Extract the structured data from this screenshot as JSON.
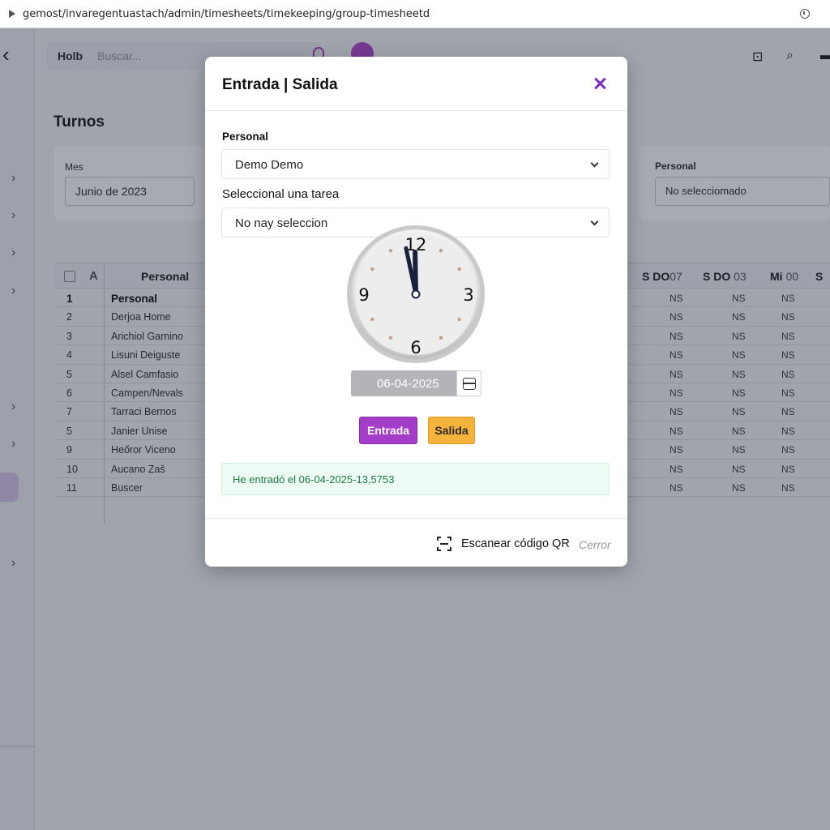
{
  "browser": {
    "url": "gemost/invaregentuastach/admin/timesheets/timekeeping/group-timesheetd"
  },
  "app": {
    "topbar": {
      "label": "Holb",
      "search_placeholder": "Buscar..."
    },
    "page_title": "Turnos",
    "filters": {
      "month_label": "Mes",
      "month_value": "Junio de 2023",
      "personal_label": "Personal",
      "personal_value": "No selecciomado"
    },
    "table": {
      "header_personal": "Personal",
      "days": [
        {
          "letter": "S",
          "code": "DO",
          "num": "07"
        },
        {
          "letter": "S",
          "code": "DO",
          "num": "03"
        },
        {
          "letter": "Mi",
          "num": "00"
        },
        {
          "letter": "S"
        }
      ],
      "rows": [
        {
          "num": "1",
          "name": "Personal",
          "ns": [
            "NS",
            "NS",
            "NS"
          ]
        },
        {
          "num": "2",
          "name": "Derjoa Home",
          "ns": [
            "NS",
            "NS",
            "NS"
          ]
        },
        {
          "num": "3",
          "name": "Arichiol Garnino",
          "ns": [
            "NS",
            "NS",
            "NS"
          ]
        },
        {
          "num": "4",
          "name": "Lisuni Deiguste",
          "ns": [
            "NS",
            "NS",
            "NS"
          ]
        },
        {
          "num": "5",
          "name": "Alsel Camfasio",
          "ns": [
            "NS",
            "NS",
            "NS"
          ]
        },
        {
          "num": "6",
          "name": "Campen/Nevals",
          "ns": [
            "NS",
            "NS",
            "NS"
          ]
        },
        {
          "num": "7",
          "name": "Tarraci Bernos",
          "ns": [
            "NS",
            "NS",
            "NS"
          ]
        },
        {
          "num": "5",
          "name": "Janier Unise",
          "ns": [
            "NS",
            "NS",
            "NS"
          ]
        },
        {
          "num": "9",
          "name": "Heőror Viceno",
          "ns": [
            "NS",
            "NS",
            "NS"
          ]
        },
        {
          "num": "10",
          "name": "Aucano Zaš",
          "ns": [
            "NS",
            "NS",
            "NS"
          ]
        },
        {
          "num": "11",
          "name": "Buscer",
          "ns": [
            "NS",
            "NS",
            "NS"
          ]
        }
      ]
    }
  },
  "modal": {
    "title": "Entrada | Salida",
    "personal_label": "Personal",
    "personal_value": "Demo Demo",
    "task_label": "Seleccional una tarea",
    "task_value": "No nay seleccion",
    "clock": {
      "n12": "12",
      "n3": "3",
      "n6": "6",
      "n9": "9",
      "hour": 11,
      "minute": 58
    },
    "date_value": "06-04-2025",
    "entrada_label": "Entrada",
    "salida_label": "Salida",
    "alert_message": "He entradó el 06-04-2025-13,5753",
    "qr_label": "Escanear código QR",
    "close_label": "Cerror"
  },
  "colors": {
    "accent_purple": "#a43ec8",
    "salida_amber": "#f4b43c",
    "success_text": "#1c7a45"
  }
}
